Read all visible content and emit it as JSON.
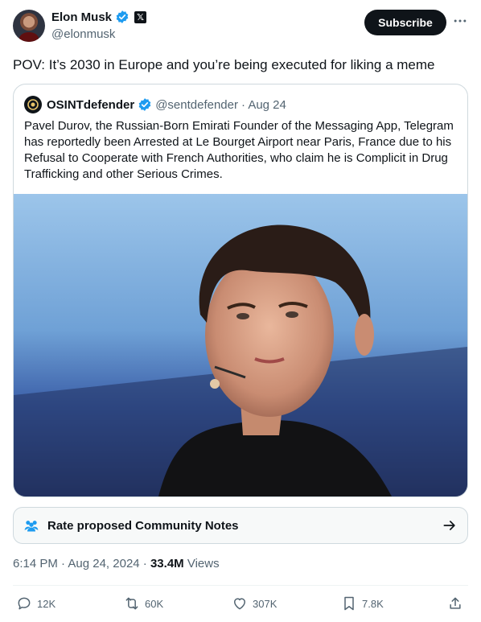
{
  "author": {
    "name": "Elon Musk",
    "handle": "@elonmusk",
    "avatar_icon": "avatar",
    "badges": [
      "verified-icon",
      "x-affiliation-icon"
    ]
  },
  "header": {
    "subscribe_label": "Subscribe",
    "more_icon": "more-icon"
  },
  "tweet": {
    "text": "POV: It’s 2030 in Europe and you’re being executed for liking a meme"
  },
  "quote": {
    "name": "OSINTdefender",
    "handle": "@sentdefender",
    "date": "· Aug 24",
    "text": "Pavel Durov, the Russian-Born Emirati Founder of the Messaging App, Telegram has reportedly been Arrested at Le Bourget Airport near Paris, France due to his Refusal to Cooperate with French Authorities, who claim he is Complicit in Drug Trafficking and other Serious Crimes.",
    "photo": "photo"
  },
  "community_notes": {
    "label": "Rate proposed Community Notes",
    "icon": "people-icon",
    "arrow_icon": "arrow-right-icon"
  },
  "meta": {
    "time": "6:14 PM",
    "date": "· Aug 24, 2024 ·",
    "views_count": "33.4M",
    "views_label": "Views"
  },
  "actions": {
    "replies": "12K",
    "reposts": "60K",
    "likes": "307K",
    "bookmarks": "7.8K"
  },
  "colors": {
    "text": "#0f1419",
    "secondary": "#536471",
    "verified": "#1d9bf0",
    "border": "#cfd9de"
  }
}
